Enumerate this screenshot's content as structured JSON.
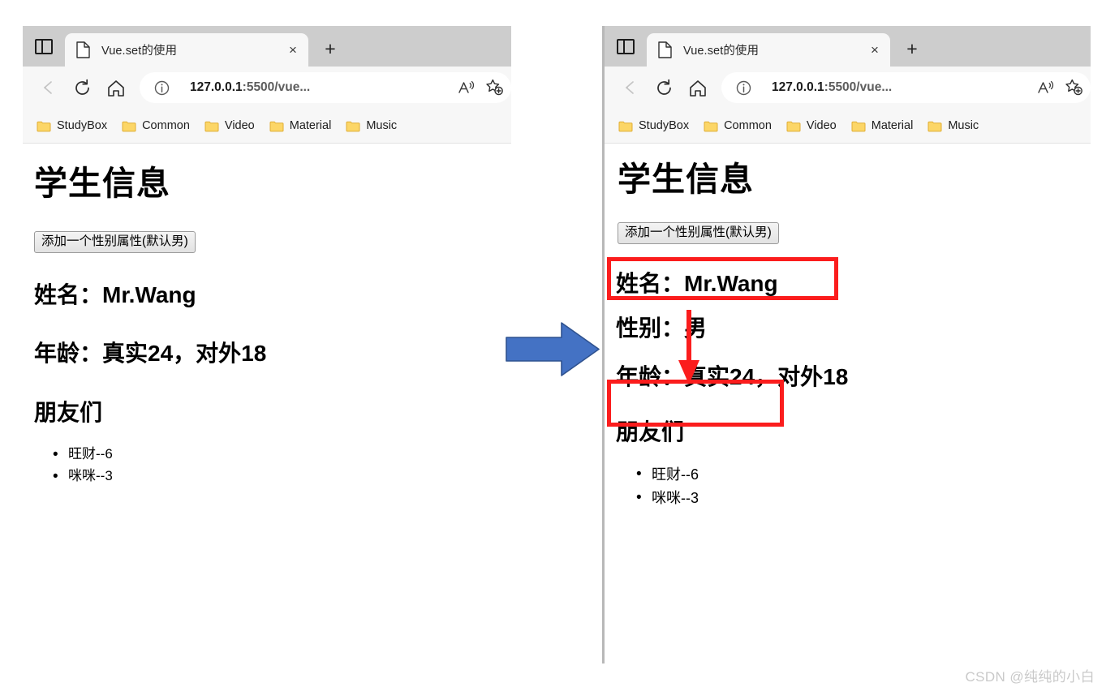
{
  "browser": {
    "tab": {
      "title": "Vue.set的使用",
      "close_label": "×",
      "favicon": "page-icon"
    },
    "new_tab_label": "+",
    "toolbar": {
      "back": "←",
      "reload": "reload-icon",
      "home": "home-icon",
      "info": "info-icon",
      "url_host": "127.0.0.1",
      "url_rest": ":5500/vue...",
      "read_aloud": "A",
      "favorites": "star-plus-icon"
    },
    "bookmarks": [
      {
        "label": "StudyBox"
      },
      {
        "label": "Common"
      },
      {
        "label": "Video"
      },
      {
        "label": "Material"
      },
      {
        "label": "Music"
      }
    ]
  },
  "left_page": {
    "title": "学生信息",
    "button_label": "添加一个性别属性(默认男)",
    "name_row": "姓名：Mr.Wang",
    "age_row": "年龄：真实24，对外18",
    "friends_heading": "朋友们",
    "friends": [
      "旺财--6",
      "咪咪--3"
    ]
  },
  "right_page": {
    "title": "学生信息",
    "button_label": "添加一个性别属性(默认男)",
    "name_row": "姓名：Mr.Wang",
    "gender_row": "性别：男",
    "age_row": "年龄：真实24，对外18",
    "friends_heading": "朋友们",
    "friends": [
      "旺财--6",
      "咪咪--3"
    ]
  },
  "annotations": {
    "highlight_color": "#fb1d1d",
    "transition_arrow_color": "#4472c4",
    "pointer_arrow_color": "#fb1d1d",
    "highlight_button": "添加一个性别属性(默认男)",
    "highlight_gender": "性别：男"
  },
  "watermark": "CSDN @纯纯的小白"
}
